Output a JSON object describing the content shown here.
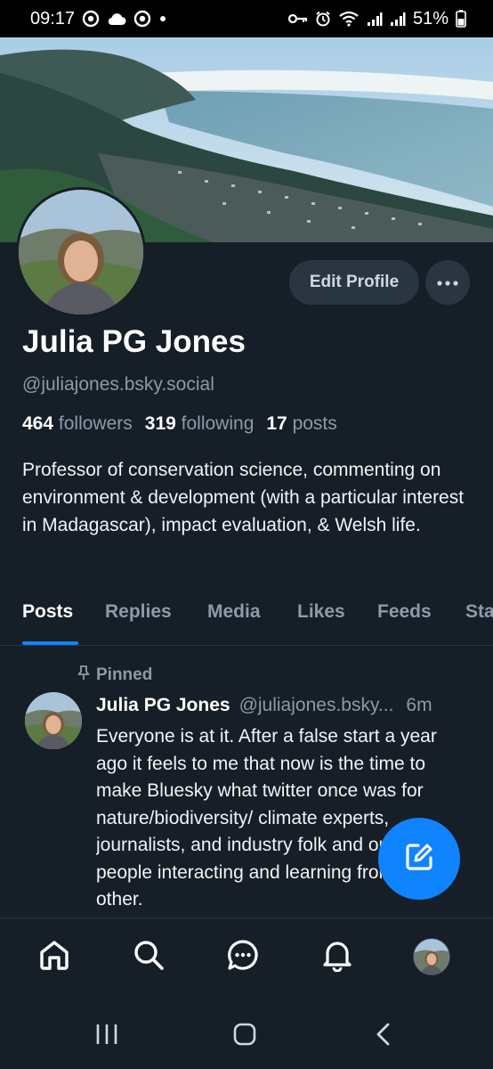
{
  "status_bar": {
    "time": "09:17",
    "battery": "51%"
  },
  "profile": {
    "name": "Julia PG Jones",
    "handle": "@juliajones.bsky.social",
    "edit_button": "Edit Profile",
    "followers_count": "464",
    "followers_label": "followers",
    "following_count": "319",
    "following_label": "following",
    "posts_count": "17",
    "posts_label": "posts",
    "bio": "Professor of conservation science, commenting on environment & development (with a particular interest in Madagascar), impact evaluation, & Welsh life."
  },
  "tabs": [
    {
      "label": "Posts",
      "active": true
    },
    {
      "label": "Replies"
    },
    {
      "label": "Media"
    },
    {
      "label": "Likes"
    },
    {
      "label": "Feeds"
    },
    {
      "label": "Starter Packs"
    }
  ],
  "post": {
    "pinned_label": "Pinned",
    "author_name": "Julia PG Jones",
    "author_handle": "@juliajones.bsky...",
    "time": "6m",
    "text": "Everyone is at it. After a false start a year ago it feels to me that now is the time to make Bluesky what twitter once was for nature/biodiversity/ climate experts, journalists, and industry folk and ordinary people interacting and learning from each other."
  },
  "colors": {
    "background": "#161e27",
    "accent": "#1083fe",
    "muted_text": "#8d9aa9",
    "button_bg": "#2a3542"
  },
  "icons": {
    "bottom_nav": [
      "home-icon",
      "search-icon",
      "chat-icon",
      "bell-icon",
      "avatar"
    ],
    "fab": "compose-icon",
    "system_nav": [
      "recents-icon",
      "home-button-icon",
      "back-icon"
    ]
  }
}
